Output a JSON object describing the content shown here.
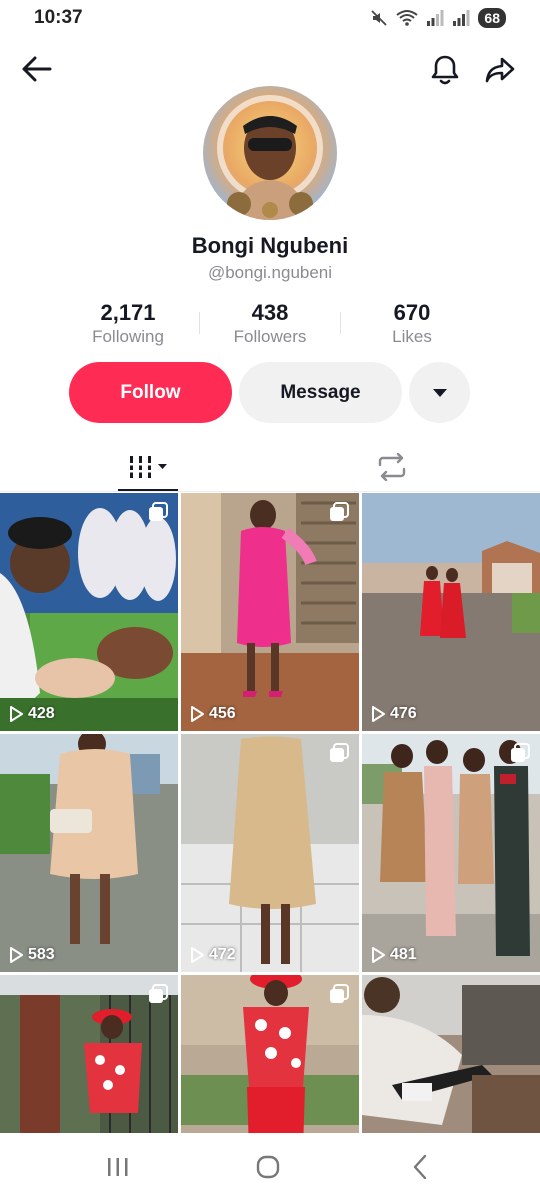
{
  "status_bar": {
    "time": "10:37",
    "battery": "68",
    "icons": [
      "mute-icon",
      "wifi-icon",
      "signal-icon",
      "signal-icon",
      "battery-icon"
    ]
  },
  "top_bar": {
    "icons": [
      "back-arrow-icon",
      "bell-icon",
      "share-icon"
    ]
  },
  "profile": {
    "display_name": "Bongi Ngubeni",
    "username": "@bongi.ngubeni",
    "stats": [
      {
        "value": "2,171",
        "label": "Following"
      },
      {
        "value": "438",
        "label": "Followers"
      },
      {
        "value": "670",
        "label": "Likes"
      }
    ]
  },
  "actions": {
    "follow_label": "Follow",
    "message_label": "Message",
    "more_icon": "caret-down-icon"
  },
  "colors": {
    "accent": "#fe2c55",
    "secondary_button": "#f1f1f2",
    "text": "#161823",
    "muted_text": "#8a8b91"
  },
  "tabs": [
    {
      "name": "videos",
      "icon": "grid-icon",
      "active": true
    },
    {
      "name": "reposts",
      "icon": "repost-icon",
      "active": false
    }
  ],
  "videos": [
    {
      "views": "428",
      "multi": true
    },
    {
      "views": "456",
      "multi": true
    },
    {
      "views": "476",
      "multi": false
    },
    {
      "views": "583",
      "multi": false
    },
    {
      "views": "472",
      "multi": true
    },
    {
      "views": "481",
      "multi": true
    },
    {
      "views": "",
      "multi": true
    },
    {
      "views": "",
      "multi": true
    },
    {
      "views": "",
      "multi": false
    }
  ],
  "nav_bar": {
    "icons": [
      "recent-apps-icon",
      "home-icon",
      "back-icon"
    ]
  }
}
